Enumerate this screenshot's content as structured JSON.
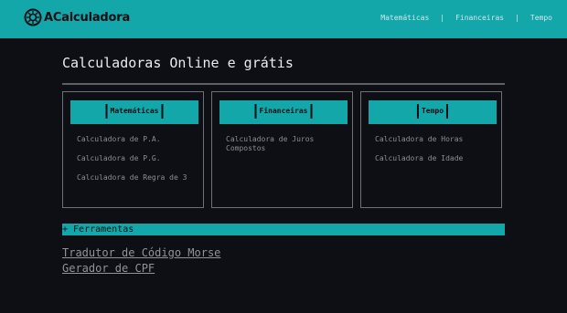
{
  "brand": {
    "name": "ACalculadora",
    "color": "#14a7aa"
  },
  "nav": {
    "items": [
      "Matemáticas",
      "Financeiras",
      "Tempo"
    ],
    "separator": "|"
  },
  "main": {
    "title": "Calculadoras Online e grátis"
  },
  "categories": [
    {
      "label": "Matemáticas",
      "links": [
        "Calculadora de P.A.",
        "Calculadora de P.G.",
        "Calculadora de Regra de 3"
      ]
    },
    {
      "label": "Financeiras",
      "links": [
        "Calculadora de Juros Compostos"
      ]
    },
    {
      "label": "Tempo",
      "links": [
        "Calculadora de Horas",
        "Calculadora de Idade"
      ]
    }
  ],
  "tools": {
    "label": "+ Ferramentas",
    "links": [
      "Tradutor de Código Morse",
      "Gerador de CPF"
    ]
  }
}
